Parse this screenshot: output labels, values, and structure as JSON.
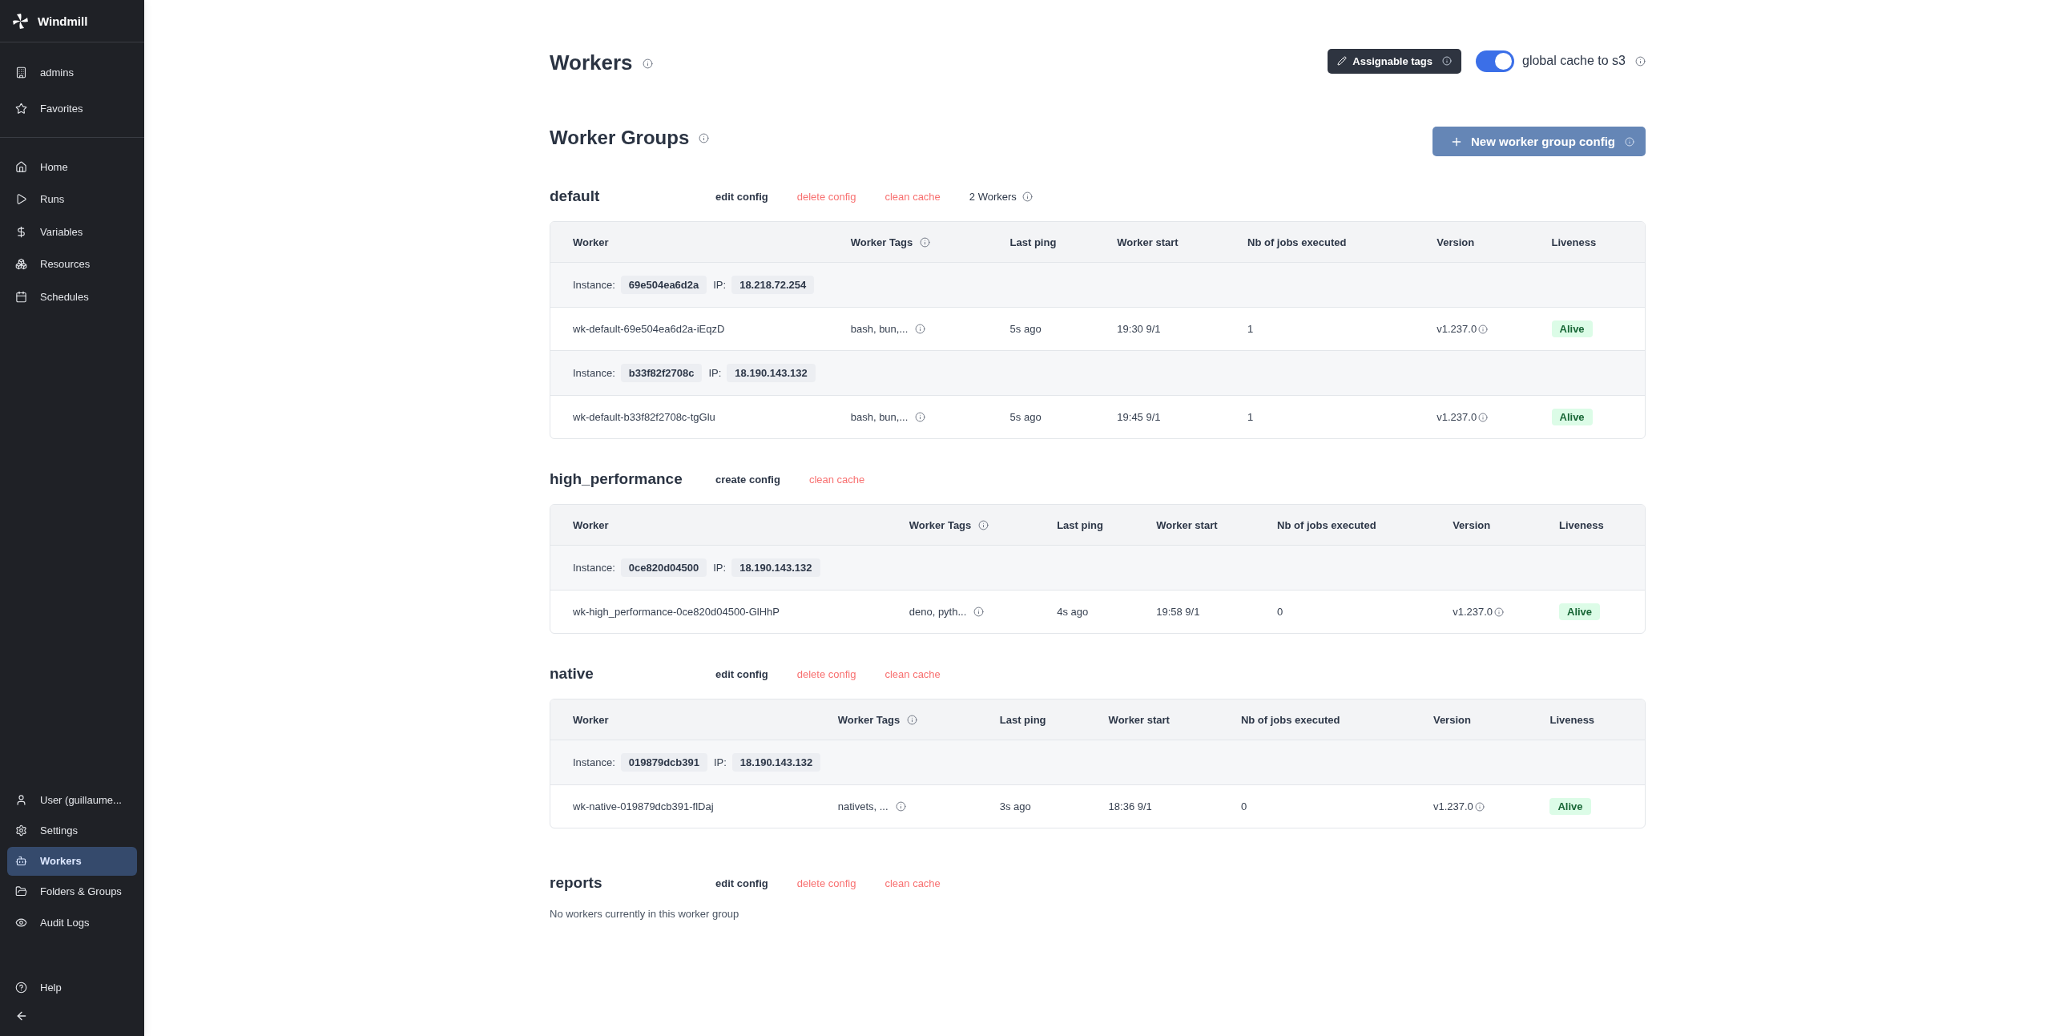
{
  "sidebar": {
    "logo": "Windmill",
    "workspace_items": [
      {
        "label": "admins",
        "selected": false
      },
      {
        "label": "Favorites",
        "selected": false
      }
    ],
    "main_items": [
      {
        "label": "Home",
        "selected": false
      },
      {
        "label": "Runs",
        "selected": false
      },
      {
        "label": "Variables",
        "selected": false
      },
      {
        "label": "Resources",
        "selected": false
      },
      {
        "label": "Schedules",
        "selected": false
      }
    ],
    "bottom_items": [
      {
        "label": "User (guillaume...",
        "selected": false
      },
      {
        "label": "Settings",
        "selected": false
      },
      {
        "label": "Workers",
        "selected": true
      },
      {
        "label": "Folders & Groups",
        "selected": false
      },
      {
        "label": "Audit Logs",
        "selected": false
      }
    ],
    "footer_items": [
      {
        "label": "Help",
        "selected": false
      }
    ]
  },
  "page": {
    "title": "Workers",
    "assignable_tags_button": "Assignable tags",
    "global_cache": {
      "label": "global cache to s3",
      "on": true
    }
  },
  "worker_groups": {
    "title": "Worker Groups",
    "new_button": "New worker group config",
    "groups": [
      {
        "name": "default",
        "actions": [
          {
            "label": "edit config",
            "kind": "neutral"
          },
          {
            "label": "delete config",
            "kind": "danger"
          },
          {
            "label": "clean cache",
            "kind": "danger"
          }
        ],
        "worker_count": "2 Workers",
        "columns": [
          {
            "label": "Worker",
            "info": false
          },
          {
            "label": "Worker Tags",
            "info": true
          },
          {
            "label": "Last ping",
            "info": false
          },
          {
            "label": "Worker start",
            "info": false
          },
          {
            "label": "Nb of jobs executed",
            "info": false
          },
          {
            "label": "Version",
            "info": false
          },
          {
            "label": "Liveness",
            "info": false
          }
        ],
        "instances": [
          {
            "instance_label": "Instance:",
            "instance": "69e504ea6d2a",
            "ip_label": "IP:",
            "ip": "18.218.72.254",
            "workers": [
              {
                "name": "wk-default-69e504ea6d2a-iEqzD",
                "tags": "bash, bun,...",
                "last_ping": "5s ago",
                "started": "19:30 9/1",
                "jobs": "1",
                "version": "v1.237.0",
                "liveness": "Alive"
              }
            ]
          },
          {
            "instance_label": "Instance:",
            "instance": "b33f82f2708c",
            "ip_label": "IP:",
            "ip": "18.190.143.132",
            "workers": [
              {
                "name": "wk-default-b33f82f2708c-tgGlu",
                "tags": "bash, bun,...",
                "last_ping": "5s ago",
                "started": "19:45 9/1",
                "jobs": "1",
                "version": "v1.237.0",
                "liveness": "Alive"
              }
            ]
          }
        ]
      },
      {
        "name": "high_performance",
        "actions": [
          {
            "label": "create config",
            "kind": "neutral"
          },
          {
            "label": "clean cache",
            "kind": "danger"
          }
        ],
        "columns": [
          {
            "label": "Worker",
            "info": false
          },
          {
            "label": "Worker Tags",
            "info": true
          },
          {
            "label": "Last ping",
            "info": false
          },
          {
            "label": "Worker start",
            "info": false
          },
          {
            "label": "Nb of jobs executed",
            "info": false
          },
          {
            "label": "Version",
            "info": false
          },
          {
            "label": "Liveness",
            "info": false
          }
        ],
        "instances": [
          {
            "instance_label": "Instance:",
            "instance": "0ce820d04500",
            "ip_label": "IP:",
            "ip": "18.190.143.132",
            "workers": [
              {
                "name": "wk-high_performance-0ce820d04500-GlHhP",
                "tags": "deno, pyth...",
                "last_ping": "4s ago",
                "started": "19:58 9/1",
                "jobs": "0",
                "version": "v1.237.0",
                "liveness": "Alive"
              }
            ]
          }
        ]
      },
      {
        "name": "native",
        "actions": [
          {
            "label": "edit config",
            "kind": "neutral"
          },
          {
            "label": "delete config",
            "kind": "danger"
          },
          {
            "label": "clean cache",
            "kind": "danger"
          }
        ],
        "columns": [
          {
            "label": "Worker",
            "info": false
          },
          {
            "label": "Worker Tags",
            "info": true
          },
          {
            "label": "Last ping",
            "info": false
          },
          {
            "label": "Worker start",
            "info": false
          },
          {
            "label": "Nb of jobs executed",
            "info": false
          },
          {
            "label": "Version",
            "info": false
          },
          {
            "label": "Liveness",
            "info": false
          }
        ],
        "instances": [
          {
            "instance_label": "Instance:",
            "instance": "019879dcb391",
            "ip_label": "IP:",
            "ip": "18.190.143.132",
            "workers": [
              {
                "name": "wk-native-019879dcb391-flDaj",
                "tags": "nativets, ...",
                "last_ping": "3s ago",
                "started": "18:36 9/1",
                "jobs": "0",
                "version": "v1.237.0",
                "liveness": "Alive"
              }
            ]
          }
        ]
      },
      {
        "name": "reports",
        "actions": [
          {
            "label": "edit config",
            "kind": "neutral"
          },
          {
            "label": "delete config",
            "kind": "danger"
          },
          {
            "label": "clean cache",
            "kind": "danger"
          }
        ],
        "empty_message": "No workers currently in this worker group"
      }
    ]
  }
}
